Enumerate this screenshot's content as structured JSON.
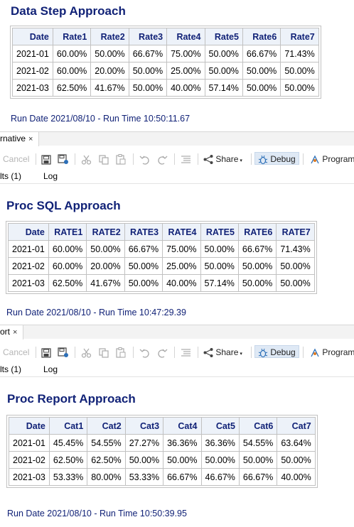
{
  "section1": {
    "title": "Data Step Approach",
    "headers": [
      "Date",
      "Rate1",
      "Rate2",
      "Rate3",
      "Rate4",
      "Rate5",
      "Rate6",
      "Rate7"
    ],
    "rows": [
      [
        "2021-01",
        "60.00%",
        "50.00%",
        "66.67%",
        "75.00%",
        "50.00%",
        "66.67%",
        "71.43%"
      ],
      [
        "2021-02",
        "60.00%",
        "20.00%",
        "50.00%",
        "25.00%",
        "50.00%",
        "50.00%",
        "50.00%"
      ],
      [
        "2021-03",
        "62.50%",
        "41.67%",
        "50.00%",
        "40.00%",
        "57.14%",
        "50.00%",
        "50.00%"
      ]
    ],
    "run_text": "Run Date 2021/08/10 - Run Time 10:50:11.67"
  },
  "editor1": {
    "tab_label": "rnative",
    "tab_close": "×",
    "toolbar": {
      "cancel": "Cancel",
      "share": "Share",
      "debug": "Debug",
      "program": "Program"
    },
    "subtabs": [
      "lts (1)",
      "Log"
    ]
  },
  "section2": {
    "title": "Proc SQL Approach",
    "headers": [
      "Date",
      "RATE1",
      "RATE2",
      "RATE3",
      "RATE4",
      "RATE5",
      "RATE6",
      "RATE7"
    ],
    "rows": [
      [
        "2021-01",
        "60.00%",
        "50.00%",
        "66.67%",
        "75.00%",
        "50.00%",
        "66.67%",
        "71.43%"
      ],
      [
        "2021-02",
        "60.00%",
        "20.00%",
        "50.00%",
        "25.00%",
        "50.00%",
        "50.00%",
        "50.00%"
      ],
      [
        "2021-03",
        "62.50%",
        "41.67%",
        "50.00%",
        "40.00%",
        "57.14%",
        "50.00%",
        "50.00%"
      ]
    ],
    "run_text": "Run Date 2021/08/10 - Run Time 10:47:29.39"
  },
  "editor2": {
    "tab_label": "ort",
    "tab_close": "×",
    "toolbar": {
      "cancel": "Cancel",
      "share": "Share",
      "debug": "Debug",
      "program": "Program"
    },
    "subtabs": [
      "lts (1)",
      "Log"
    ]
  },
  "section3": {
    "title": "Proc Report Approach",
    "headers": [
      "Date",
      "Cat1",
      "Cat2",
      "Cat3",
      "Cat4",
      "Cat5",
      "Cat6",
      "Cat7"
    ],
    "rows": [
      [
        "2021-01",
        "45.45%",
        "54.55%",
        "27.27%",
        "36.36%",
        "36.36%",
        "54.55%",
        "63.64%"
      ],
      [
        "2021-02",
        "62.50%",
        "62.50%",
        "50.00%",
        "50.00%",
        "50.00%",
        "50.00%",
        "50.00%"
      ],
      [
        "2021-03",
        "53.33%",
        "80.00%",
        "53.33%",
        "66.67%",
        "46.67%",
        "66.67%",
        "40.00%"
      ]
    ],
    "run_text": "Run Date 2021/08/10 - Run Time 10:50:39.95"
  },
  "colors": {
    "title": "#112277",
    "header_bg": "#edf2f9",
    "border": "#c1c1c1"
  }
}
